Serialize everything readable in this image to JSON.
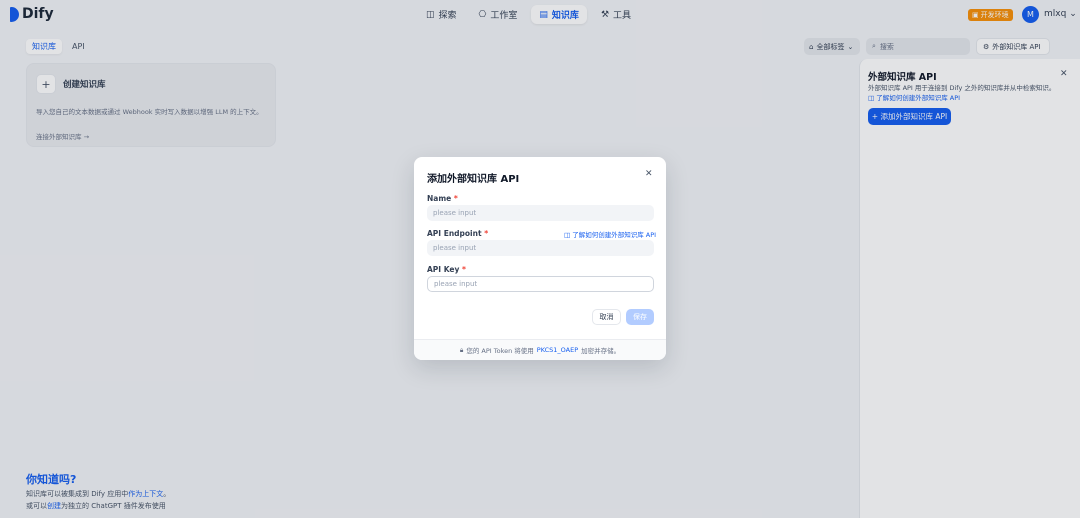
{
  "brand": {
    "name": "Dify"
  },
  "nav": [
    {
      "icon": "◫",
      "label": "探索"
    },
    {
      "icon": "⎔",
      "label": "工作室"
    },
    {
      "icon": "▤",
      "label": "知识库"
    },
    {
      "icon": "⚒",
      "label": "工具"
    }
  ],
  "env_badge": "开发环境",
  "user": {
    "initial": "M",
    "name": "mlxq"
  },
  "tabs": [
    "知识库",
    "API"
  ],
  "tools": {
    "tags_label": "全部标签",
    "search_placeholder": "搜索",
    "external_api_label": "外部知识库 API"
  },
  "create_card": {
    "title": "创建知识库",
    "description": "导入您自己的文本数据或通过 Webhook 实时写入数据以增强 LLM 的上下文。",
    "link": "连接外部知识库 →"
  },
  "panel": {
    "title": "外部知识库 API",
    "description": "外部知识库 API 用于连接到 Dify 之外的知识库并从中检索知识。",
    "link": "了解如何创建外部知识库 API",
    "add_button": "+ 添加外部知识库 API"
  },
  "tip": {
    "title": "你知道吗?",
    "line1_pre": "知识库可以被集成到 Dify 应用中",
    "line1_link": "作为上下文",
    "line1_post": "。",
    "line2_pre": "或可以",
    "line2_link": "创建",
    "line2_post": "为独立的 ChatGPT 插件发布使用"
  },
  "modal": {
    "title": "添加外部知识库 API",
    "name_label": "Name",
    "endpoint_label": "API Endpoint",
    "key_label": "API Key",
    "required_mark": "*",
    "placeholder": "please input",
    "doc_link": "了解如何创建外部知识库 API",
    "cancel": "取消",
    "save": "保存",
    "footer_pre": "您的 API Token 将使用",
    "footer_link": "PKCS1_OAEP",
    "footer_post": "加密并存储。"
  }
}
